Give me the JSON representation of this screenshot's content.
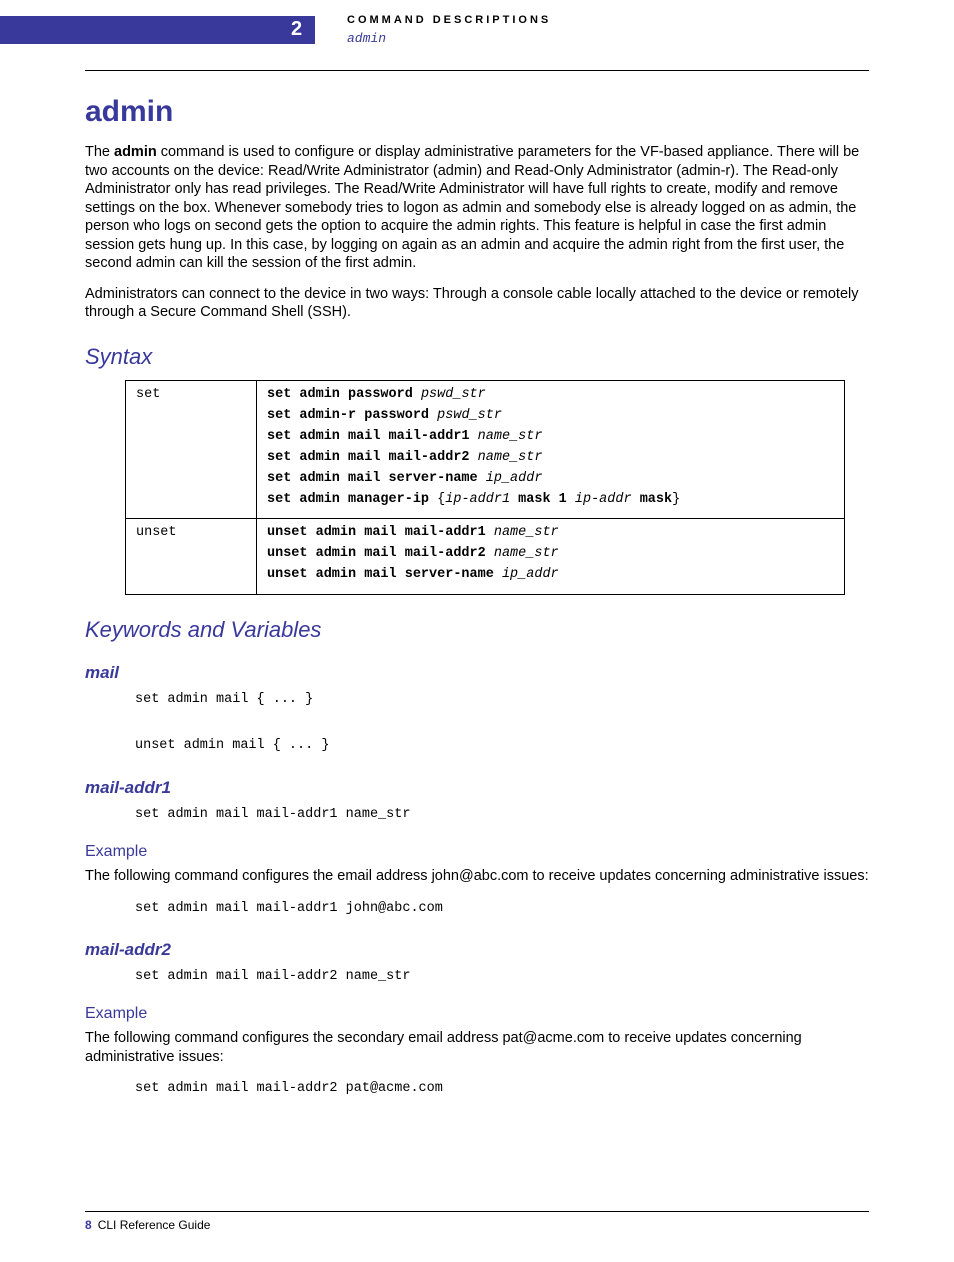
{
  "header": {
    "chapter_number": "2",
    "section_label": "COMMAND DESCRIPTIONS",
    "subsection": "admin"
  },
  "title": "admin",
  "intro": {
    "p1_prefix": "The ",
    "p1_bold": "admin",
    "p1_rest": " command is used to configure or display administrative parameters for the VF-based appliance. There will be two accounts on the device: Read/Write Administrator (admin) and Read-Only Administrator (admin-r). The Read-only Administrator only has read privileges. The Read/Write Administrator will have full rights to create, modify and remove settings on the box. Whenever somebody tries to logon as admin and somebody else is already logged on as admin, the person who logs on second gets the option to acquire the admin rights. This feature is helpful in case the first admin session gets hung up. In this case, by logging on again as an admin and acquire the admin right from the first user, the second admin can kill the session of the first admin.",
    "p2": "Administrators can connect to the device in two ways: Through a console cable locally attached to the device or remotely through a Secure Command Shell (SSH)."
  },
  "syntax": {
    "heading": "Syntax",
    "rows": {
      "set": {
        "key": "set",
        "l1b": "set admin password ",
        "l1i": "pswd_str",
        "l2b": "set admin-r password ",
        "l2i": "pswd_str",
        "l3b": "set admin mail mail-addr1 ",
        "l3i": "name_str",
        "l4b": "set admin mail mail-addr2 ",
        "l4i": "name_str",
        "l5b": "set admin mail server-name ",
        "l5i": "ip_addr",
        "l6b1": "set admin manager-ip ",
        "l6p1": "{",
        "l6i1": "ip-addr1",
        "l6b2": " mask 1 ",
        "l6i2": "ip-addr",
        "l6b3": " mask",
        "l6p2": "}"
      },
      "unset": {
        "key": "unset",
        "l1b": "unset admin mail mail-addr1 ",
        "l1i": "name_str",
        "l2b": "unset admin mail mail-addr2 ",
        "l2i": "name_str",
        "l3b": "unset admin mail server-name ",
        "l3i": "ip_addr"
      }
    }
  },
  "kv": {
    "heading": "Keywords and Variables",
    "mail": {
      "heading": "mail",
      "code": "set admin mail { ... }\n\nunset admin mail { ... }"
    },
    "mail_addr1": {
      "heading": "mail-addr1",
      "code": "set admin mail mail-addr1 name_str",
      "example_label": "Example",
      "example_text": "The following command configures the email address john@abc.com to receive updates concerning administrative issues:",
      "example_code": "set admin mail mail-addr1 john@abc.com"
    },
    "mail_addr2": {
      "heading": "mail-addr2",
      "code": "set admin mail mail-addr2 name_str",
      "example_label": "Example",
      "example_text": "The following command configures the secondary email address pat@acme.com to receive updates concerning administrative issues:",
      "example_code": "set admin mail mail-addr2 pat@acme.com"
    }
  },
  "footer": {
    "page_number": "8",
    "doc_title": "CLI Reference Guide"
  }
}
